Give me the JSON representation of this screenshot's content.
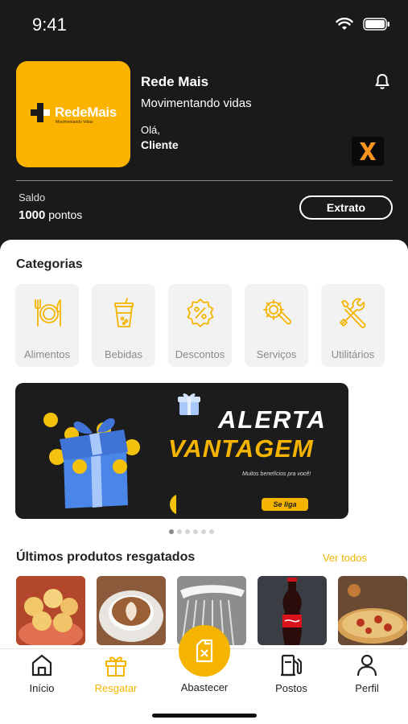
{
  "status_bar": {
    "time": "9:41"
  },
  "header": {
    "logo_text": "RedeMais",
    "logo_tagline": "Movimentando Vidas",
    "brand_name": "Rede Mais",
    "slogan": "Movimentando vidas",
    "greeting": "Olá,",
    "user_name": "Cliente",
    "partner_badge": "X"
  },
  "balance": {
    "label": "Saldo",
    "amount": "1000",
    "unit": "pontos",
    "statement_button": "Extrato"
  },
  "categories": {
    "title": "Categorias",
    "items": [
      {
        "label": "Alimentos",
        "icon": "cutlery-icon"
      },
      {
        "label": "Bebidas",
        "icon": "drink-cup-icon"
      },
      {
        "label": "Descontos",
        "icon": "discount-badge-icon"
      },
      {
        "label": "Serviços",
        "icon": "gear-wrench-icon"
      },
      {
        "label": "Utilitários",
        "icon": "tools-icon"
      }
    ]
  },
  "banner": {
    "title_line1": "ALERTA",
    "title_line2": "VANTAGEM",
    "subtitle": "Muitos benefícios pra você!",
    "cta": "Se liga",
    "slide_index": 1,
    "slide_count": 6
  },
  "products": {
    "title": "Últimos produtos resgatados",
    "see_all": "Ver todos",
    "items": [
      "cheese-bread",
      "cappuccino",
      "shower",
      "cola-bottle",
      "pizza"
    ]
  },
  "tabbar": {
    "items": [
      {
        "label": "Início",
        "icon": "home-icon"
      },
      {
        "label": "Resgatar",
        "icon": "gift-icon"
      },
      {
        "label": "Abastecer",
        "icon": "fuel-can-icon"
      },
      {
        "label": "Postos",
        "icon": "gas-station-icon"
      },
      {
        "label": "Perfil",
        "icon": "user-icon"
      }
    ],
    "active": "Resgatar"
  },
  "colors": {
    "accent": "#f4b400",
    "logo_bg": "#fbb300",
    "header_bg": "#1a1a1a"
  }
}
